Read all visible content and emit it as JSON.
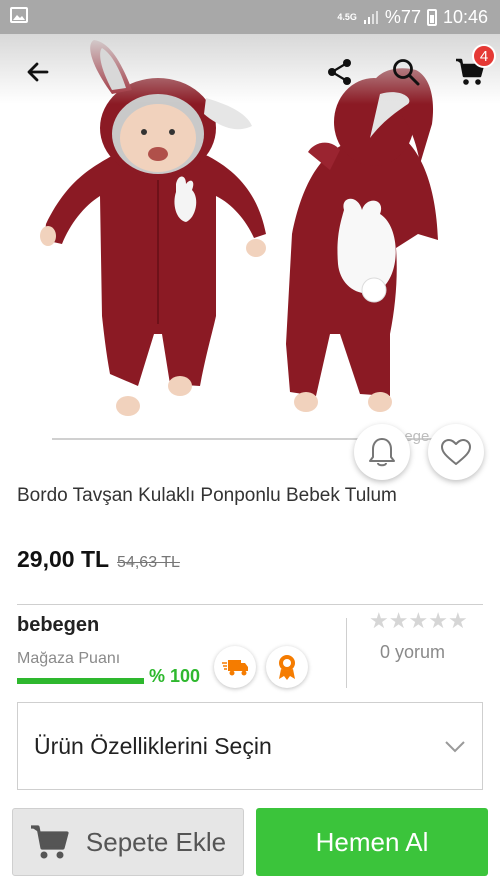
{
  "status_bar": {
    "network": "4.5G",
    "battery": "%77",
    "time": "10:46"
  },
  "app_bar": {
    "cart_count": "4",
    "icons": [
      "back-arrow-icon",
      "share-icon",
      "search-icon",
      "cart-icon"
    ]
  },
  "product": {
    "image_watermark": "bege",
    "title": "Bordo Tavşan Kulaklı Ponponlu Bebek Tulum",
    "price": "29,00 TL",
    "old_price": "54,63 TL"
  },
  "seller": {
    "name": "bebegen",
    "store_score_label": "Mağaza Puanı",
    "store_score_value": "% 100",
    "store_score_fraction": 1.0,
    "badges": [
      "fast-shipping-icon",
      "award-icon"
    ]
  },
  "reviews": {
    "rating": 0,
    "max_rating": 5,
    "count_label": "0 yorum"
  },
  "features": {
    "label": "Ürün Özelliklerini Seçin"
  },
  "actions": {
    "add_to_cart": "Sepete Ekle",
    "buy_now": "Hemen Al"
  },
  "colors": {
    "product": "#8b1a24",
    "accent_green": "#3bc43b",
    "badge_red": "#e53935",
    "badge_orange": "#f57c00"
  }
}
